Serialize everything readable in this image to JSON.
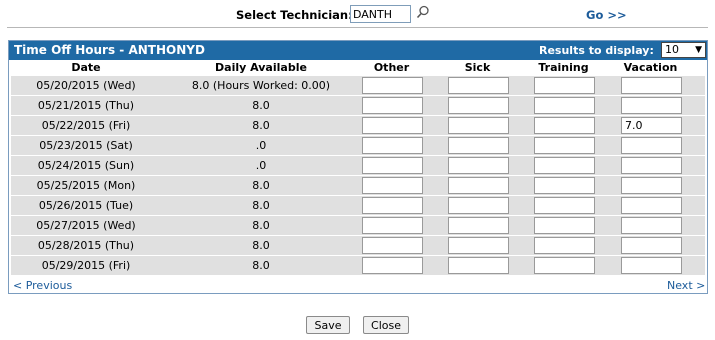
{
  "header": {
    "technician_label": "Select Technician:",
    "technician_value": "DANTH",
    "go_label": "Go >>"
  },
  "panel": {
    "title": "Time Off Hours - ANTHONYD",
    "results_label": "Results to display:",
    "results_value": "10"
  },
  "columns": [
    "Date",
    "Daily Available",
    "Other",
    "Sick",
    "Training",
    "Vacation"
  ],
  "rows": [
    {
      "date": "05/20/2015 (Wed)",
      "available": "8.0 (Hours Worked: 0.00)",
      "other": "",
      "sick": "",
      "training": "",
      "vacation": ""
    },
    {
      "date": "05/21/2015 (Thu)",
      "available": "8.0",
      "other": "",
      "sick": "",
      "training": "",
      "vacation": ""
    },
    {
      "date": "05/22/2015 (Fri)",
      "available": "8.0",
      "other": "",
      "sick": "",
      "training": "",
      "vacation": "7.0"
    },
    {
      "date": "05/23/2015 (Sat)",
      "available": ".0",
      "other": "",
      "sick": "",
      "training": "",
      "vacation": ""
    },
    {
      "date": "05/24/2015 (Sun)",
      "available": ".0",
      "other": "",
      "sick": "",
      "training": "",
      "vacation": ""
    },
    {
      "date": "05/25/2015 (Mon)",
      "available": "8.0",
      "other": "",
      "sick": "",
      "training": "",
      "vacation": ""
    },
    {
      "date": "05/26/2015 (Tue)",
      "available": "8.0",
      "other": "",
      "sick": "",
      "training": "",
      "vacation": ""
    },
    {
      "date": "05/27/2015 (Wed)",
      "available": "8.0",
      "other": "",
      "sick": "",
      "training": "",
      "vacation": ""
    },
    {
      "date": "05/28/2015 (Thu)",
      "available": "8.0",
      "other": "",
      "sick": "",
      "training": "",
      "vacation": ""
    },
    {
      "date": "05/29/2015 (Fri)",
      "available": "8.0",
      "other": "",
      "sick": "",
      "training": "",
      "vacation": ""
    }
  ],
  "pager": {
    "previous": "< Previous",
    "next": "Next >"
  },
  "actions": {
    "save": "Save",
    "close": "Close"
  }
}
